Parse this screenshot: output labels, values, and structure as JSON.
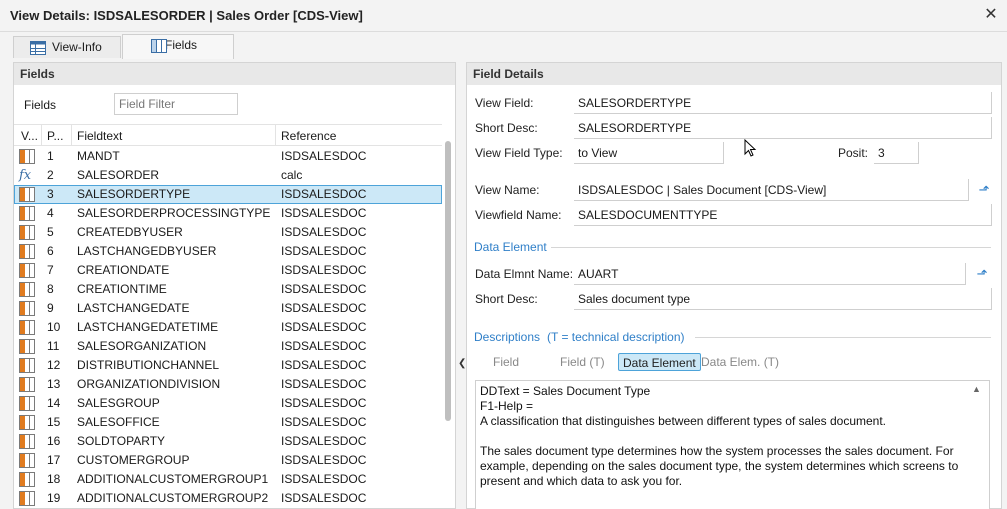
{
  "window": {
    "title": "View Details: ISDSALESORDER | Sales Order [CDS-View]"
  },
  "tabs": [
    {
      "label": "View-Info",
      "icon": "table-icon"
    },
    {
      "label": "Fields",
      "icon": "columns-icon",
      "active": true
    }
  ],
  "fields_panel": {
    "header": "Fields",
    "filter_label": "Fields",
    "filter_placeholder": "Field Filter",
    "columns": [
      "V...",
      "P...",
      "Fieldtext",
      "Reference"
    ],
    "rows": [
      {
        "icon": "field-icon",
        "pos": "1",
        "fieldtext": "MANDT",
        "reference": "ISDSALESDOC"
      },
      {
        "icon": "calc-icon",
        "pos": "2",
        "fieldtext": "SALESORDER",
        "reference": "calc"
      },
      {
        "icon": "field-icon",
        "pos": "3",
        "fieldtext": "SALESORDERTYPE",
        "reference": "ISDSALESDOC",
        "selected": true
      },
      {
        "icon": "field-icon",
        "pos": "4",
        "fieldtext": "SALESORDERPROCESSINGTYPE",
        "reference": "ISDSALESDOC"
      },
      {
        "icon": "field-icon",
        "pos": "5",
        "fieldtext": "CREATEDBYUSER",
        "reference": "ISDSALESDOC"
      },
      {
        "icon": "field-icon",
        "pos": "6",
        "fieldtext": "LASTCHANGEDBYUSER",
        "reference": "ISDSALESDOC"
      },
      {
        "icon": "field-icon",
        "pos": "7",
        "fieldtext": "CREATIONDATE",
        "reference": "ISDSALESDOC"
      },
      {
        "icon": "field-icon",
        "pos": "8",
        "fieldtext": "CREATIONTIME",
        "reference": "ISDSALESDOC"
      },
      {
        "icon": "field-icon",
        "pos": "9",
        "fieldtext": "LASTCHANGEDATE",
        "reference": "ISDSALESDOC"
      },
      {
        "icon": "field-icon",
        "pos": "10",
        "fieldtext": "LASTCHANGEDATETIME",
        "reference": "ISDSALESDOC"
      },
      {
        "icon": "field-icon",
        "pos": "11",
        "fieldtext": "SALESORGANIZATION",
        "reference": "ISDSALESDOC"
      },
      {
        "icon": "field-icon",
        "pos": "12",
        "fieldtext": "DISTRIBUTIONCHANNEL",
        "reference": "ISDSALESDOC"
      },
      {
        "icon": "field-icon",
        "pos": "13",
        "fieldtext": "ORGANIZATIONDIVISION",
        "reference": "ISDSALESDOC"
      },
      {
        "icon": "field-icon",
        "pos": "14",
        "fieldtext": "SALESGROUP",
        "reference": "ISDSALESDOC"
      },
      {
        "icon": "field-icon",
        "pos": "15",
        "fieldtext": "SALESOFFICE",
        "reference": "ISDSALESDOC"
      },
      {
        "icon": "field-icon",
        "pos": "16",
        "fieldtext": "SOLDTOPARTY",
        "reference": "ISDSALESDOC"
      },
      {
        "icon": "field-icon",
        "pos": "17",
        "fieldtext": "CUSTOMERGROUP",
        "reference": "ISDSALESDOC"
      },
      {
        "icon": "field-icon",
        "pos": "18",
        "fieldtext": "ADDITIONALCUSTOMERGROUP1",
        "reference": "ISDSALESDOC"
      },
      {
        "icon": "field-icon",
        "pos": "19",
        "fieldtext": "ADDITIONALCUSTOMERGROUP2",
        "reference": "ISDSALESDOC"
      }
    ]
  },
  "details": {
    "header": "Field Details",
    "view_field_label": "View Field:",
    "view_field": "SALESORDERTYPE",
    "short_desc_label": "Short Desc:",
    "short_desc": "SALESORDERTYPE",
    "view_field_type_label": "View Field Type:",
    "view_field_type": "to View",
    "posit_label": "Posit:",
    "posit": "3",
    "view_name_label": "View Name:",
    "view_name": "ISDSALESDOC | Sales Document [CDS-View]",
    "viewfield_name_label": "Viewfield Name:",
    "viewfield_name": "SALESDOCUMENTTYPE",
    "data_element_section": "Data Element",
    "data_elmnt_name_label": "Data Elmnt Name:",
    "data_elmnt_name": "AUART",
    "de_short_desc_label": "Short Desc:",
    "de_short_desc": "Sales document type",
    "descriptions_section": "Descriptions",
    "descriptions_note": "(T = technical description)",
    "desc_tabs": [
      "Field",
      "Field (T)",
      "Data Element",
      "Data Elem. (T)"
    ],
    "active_desc_tab": "Data Element",
    "description_text": "DDText = Sales Document Type\nF1-Help =\nA classification that distinguishes between different types of sales document.\n\nThe sales document type determines how the system processes the sales document. For example, depending on the sales document type, the system determines which screens to present and which data to ask you for."
  },
  "colors": {
    "accent": "#2f7fc8",
    "selection": "#cce8f7",
    "field_icon": "#e07b1f"
  }
}
